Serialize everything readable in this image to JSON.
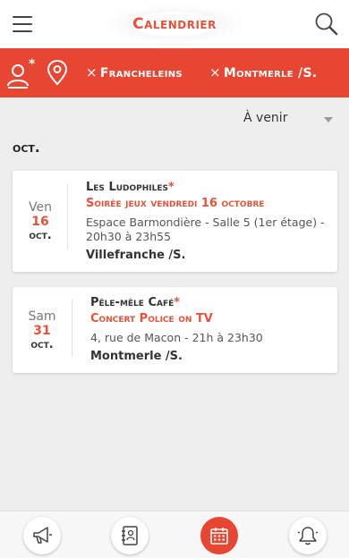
{
  "header": {
    "title": "Calendrier",
    "menu_icon": "hamburger-menu-icon",
    "search_icon": "search-icon"
  },
  "filters": {
    "user_icon": "user-filter-icon",
    "location_icon": "location-pin-icon",
    "chips": [
      {
        "remove": "×",
        "label": "Francheleins"
      },
      {
        "remove": "×",
        "label": "Montmerle /S."
      }
    ]
  },
  "sort": {
    "selected": "À venir"
  },
  "month_header": "oct.",
  "events": [
    {
      "dow": "Ven",
      "day": "16",
      "month": "oct.",
      "organizer": "Les Ludophiles",
      "star": "*",
      "title": "Soirée jeux vendredi 16 octobre",
      "place": "Espace Barmondière - Salle 5 (1er étage) - 20h30 à 23h55",
      "city": "Villefranche /S."
    },
    {
      "dow": "Sam",
      "day": "31",
      "month": "oct.",
      "organizer": "Pêle-mêle Café",
      "star": "*",
      "title": "Concert Police on TV",
      "place": "4, rue de Macon - 21h à 23h30",
      "city": "Montmerle /S."
    }
  ],
  "bottom_nav": [
    {
      "icon": "megaphone-icon",
      "active": false
    },
    {
      "icon": "address-book-icon",
      "active": false
    },
    {
      "icon": "calendar-icon",
      "active": true
    },
    {
      "icon": "bell-icon",
      "active": false
    }
  ],
  "colors": {
    "accent": "#e64632",
    "title_red": "#e8523a",
    "background": "#eeeeee"
  }
}
